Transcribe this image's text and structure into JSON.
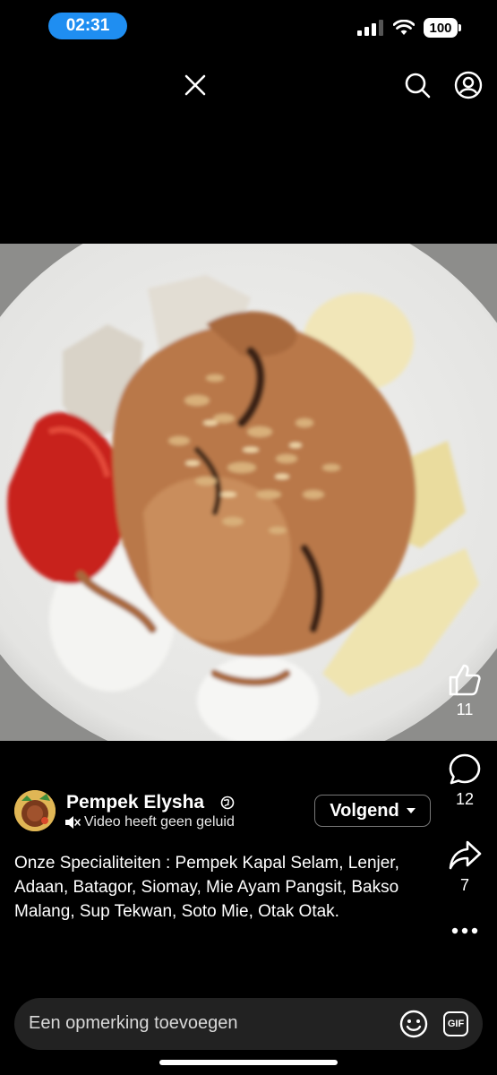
{
  "status_bar": {
    "time": "02:31",
    "battery": "100"
  },
  "post": {
    "author": "Pempek Elysha",
    "sound_notice": "Video heeft geen geluid",
    "follow_label": "Volgend",
    "caption": "Onze Specialiteiten : Pempek Kapal Selam, Lenjer, Adaan, Batagor, Siomay, Mie Ayam Pangsit, Bakso Malang, Sup Tekwan, Soto Mie, Otak Otak."
  },
  "actions": {
    "likes": "11",
    "comments": "12",
    "shares": "7"
  },
  "comment_box": {
    "placeholder": "Een opmerking toevoegen",
    "gif_label": "GIF"
  },
  "icons": {
    "close": "close-icon",
    "search": "search-icon",
    "profile": "profile-icon",
    "like": "thumbs-up-icon",
    "comment": "comment-icon",
    "share": "share-icon",
    "more": "more-icon",
    "emoji": "emoji-icon",
    "gif": "gif-icon",
    "globe": "globe-icon",
    "mute": "speaker-icon",
    "dropdown": "caret-down-icon"
  },
  "colors": {
    "time_pill": "#1f8ef1",
    "background": "#000000",
    "comment_bar": "#222222"
  }
}
